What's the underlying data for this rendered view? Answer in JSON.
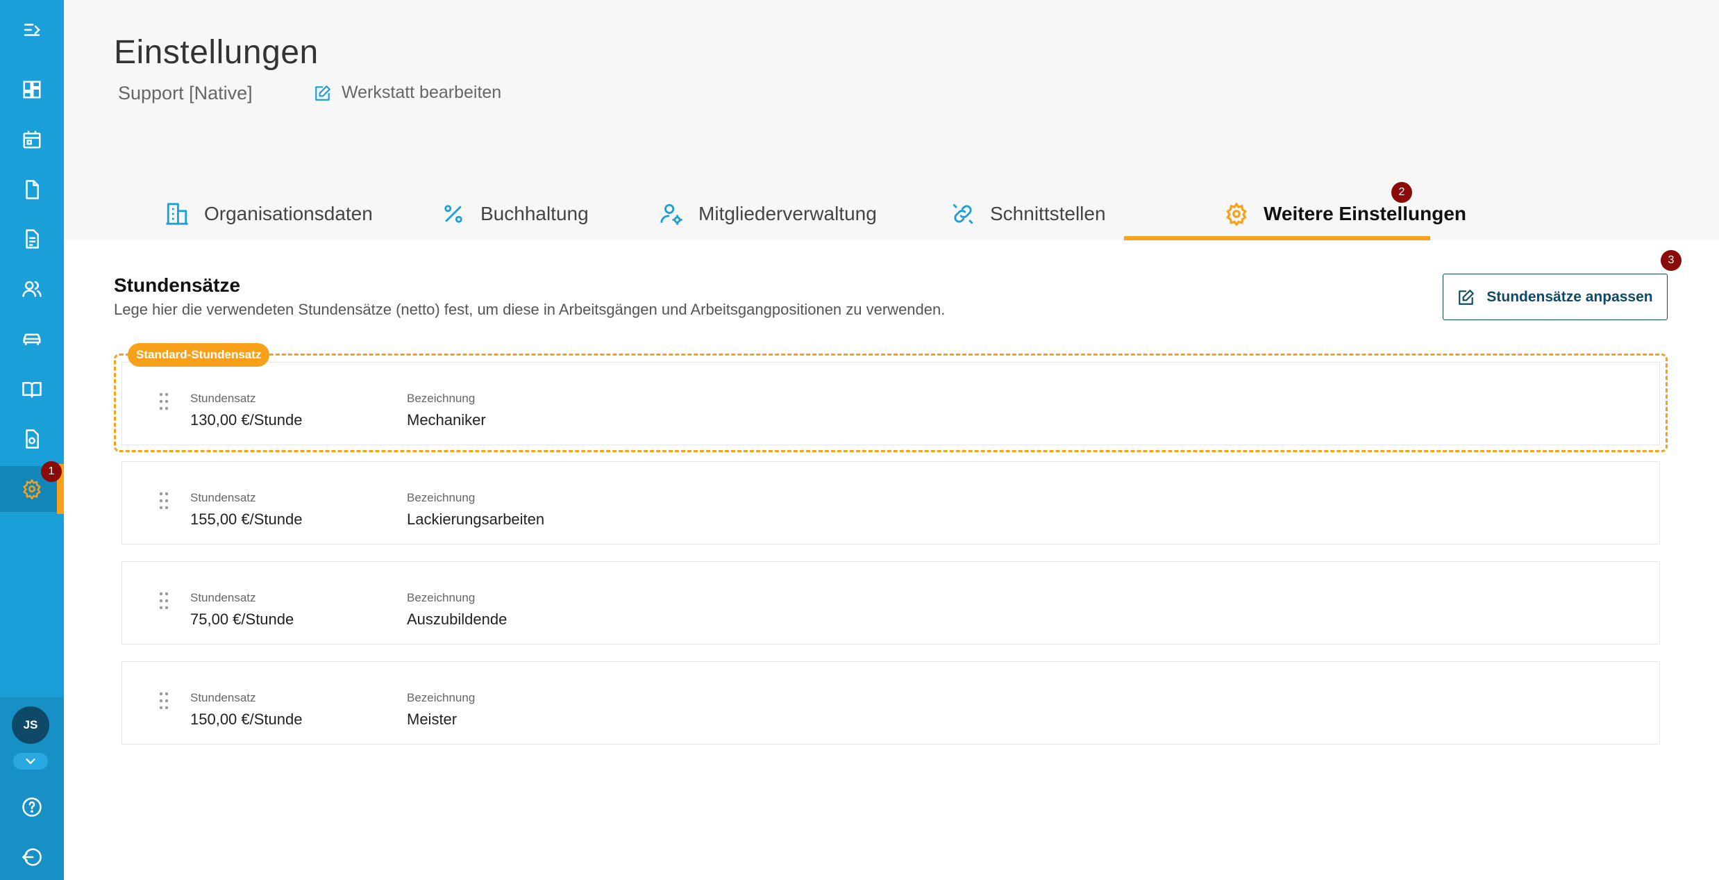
{
  "header": {
    "title": "Einstellungen",
    "workshop_name": "Support [Native]",
    "edit_workshop_label": "Werkstatt bearbeiten"
  },
  "tabs": [
    {
      "label": "Organisationsdaten",
      "icon": "building-icon",
      "active": false
    },
    {
      "label": "Buchhaltung",
      "icon": "percent-icon",
      "active": false
    },
    {
      "label": "Mitgliederverwaltung",
      "icon": "user-gear-icon",
      "active": false
    },
    {
      "label": "Schnittstellen",
      "icon": "link-icon",
      "active": false
    },
    {
      "label": "Weitere Einstellungen",
      "icon": "gear-icon",
      "active": true
    }
  ],
  "sidebar": {
    "items": [
      {
        "icon": "menu-expand-icon"
      },
      {
        "icon": "dashboard-icon"
      },
      {
        "icon": "calendar-icon"
      },
      {
        "icon": "document-icon"
      },
      {
        "icon": "invoice-icon"
      },
      {
        "icon": "customers-icon"
      },
      {
        "icon": "car-icon"
      },
      {
        "icon": "book-icon"
      },
      {
        "icon": "file-check-icon"
      },
      {
        "icon": "settings-icon",
        "active": true
      }
    ],
    "user_initials": "JS"
  },
  "badges": [
    "1",
    "2",
    "3"
  ],
  "section": {
    "title": "Stundensätze",
    "description": "Lege hier die verwendeten Stundensätze (netto) fest, um diese in Arbeitsgängen und Arbeitsgangpositionen zu verwenden.",
    "adjust_button": "Stundensätze anpassen",
    "default_tag": "Standard-Stundensatz"
  },
  "rates": [
    {
      "rate_label": "Stundensatz",
      "rate": "130,00 €/Stunde",
      "name_label": "Bezeichnung",
      "name": "Mechaniker"
    },
    {
      "rate_label": "Stundensatz",
      "rate": "155,00 €/Stunde",
      "name_label": "Bezeichnung",
      "name": "Lackierungsarbeiten"
    },
    {
      "rate_label": "Stundensatz",
      "rate": "75,00 €/Stunde",
      "name_label": "Bezeichnung",
      "name": "Auszubildende"
    },
    {
      "rate_label": "Stundensatz",
      "rate": "150,00 €/Stunde",
      "name_label": "Bezeichnung",
      "name": "Meister"
    }
  ],
  "colors": {
    "sidebar": "#1a9fd9",
    "accent": "#f7a11a",
    "primary_dark": "#0e4a68",
    "badge": "#8b0a0a"
  }
}
